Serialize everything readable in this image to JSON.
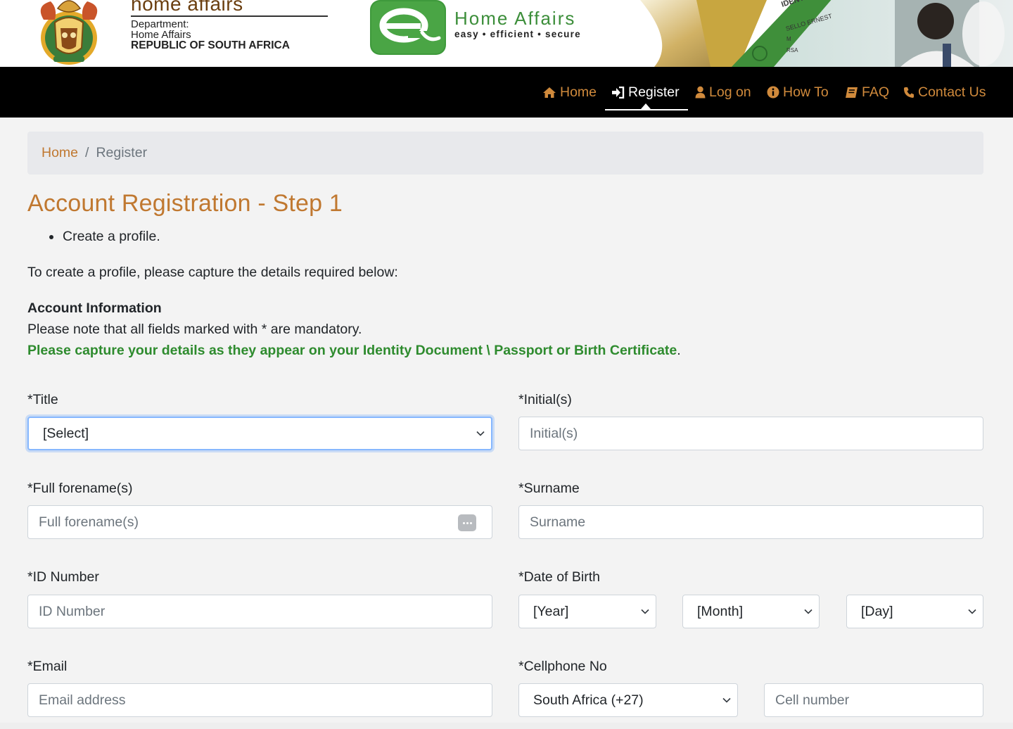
{
  "banner": {
    "dept_wordmark": "home affairs",
    "dept_line1": "Department:",
    "dept_line2": "Home Affairs",
    "dept_line3": "REPUBLIC OF SOUTH AFRICA",
    "ehome_title": "Home Affairs",
    "ehome_tagline": "easy  •  efficient  •  secure",
    "card_name": "SELLO ERNEST",
    "card_sex": "M",
    "card_country": "RSA",
    "card_header": "IDENT"
  },
  "nav": {
    "items": [
      {
        "label": "Home",
        "icon": "home-icon"
      },
      {
        "label": "Register",
        "icon": "sign-in-icon",
        "active": true
      },
      {
        "label": "Log on",
        "icon": "user-icon"
      },
      {
        "label": "How To",
        "icon": "info-circle-icon"
      },
      {
        "label": "FAQ",
        "icon": "book-icon"
      },
      {
        "label": "Contact Us",
        "icon": "phone-icon"
      }
    ]
  },
  "breadcrumb": {
    "home": "Home",
    "separator": "/",
    "current": "Register"
  },
  "page": {
    "title": "Account Registration - Step 1",
    "bullet": "Create a profile.",
    "intro": "To create a profile, please capture the details required below:",
    "section_heading": "Account Information",
    "mandatory_note": "Please note that all fields marked with * are mandatory.",
    "capture_note": "Please capture your details as they appear on your Identity Document \\ Passport or Birth Certificate",
    "capture_end": "."
  },
  "form": {
    "title": {
      "label": "*Title",
      "value": "[Select]"
    },
    "initials": {
      "label": "*Initial(s)",
      "placeholder": "Initial(s)"
    },
    "forenames": {
      "label": "*Full forename(s)",
      "placeholder": "Full forename(s)"
    },
    "surname": {
      "label": "*Surname",
      "placeholder": "Surname"
    },
    "id_number": {
      "label": "*ID Number",
      "placeholder": "ID Number"
    },
    "dob": {
      "label": "*Date of Birth",
      "year": "[Year]",
      "month": "[Month]",
      "day": "[Day]"
    },
    "email": {
      "label": "*Email",
      "placeholder": "Email address"
    },
    "cellphone": {
      "label": "*Cellphone No",
      "country": "South Africa (+27)",
      "placeholder": "Cell number"
    }
  },
  "colors": {
    "accent": "#c07830",
    "nav_link": "#d08a3c",
    "green": "#2e8b2e",
    "navbar_bg": "#000000"
  }
}
